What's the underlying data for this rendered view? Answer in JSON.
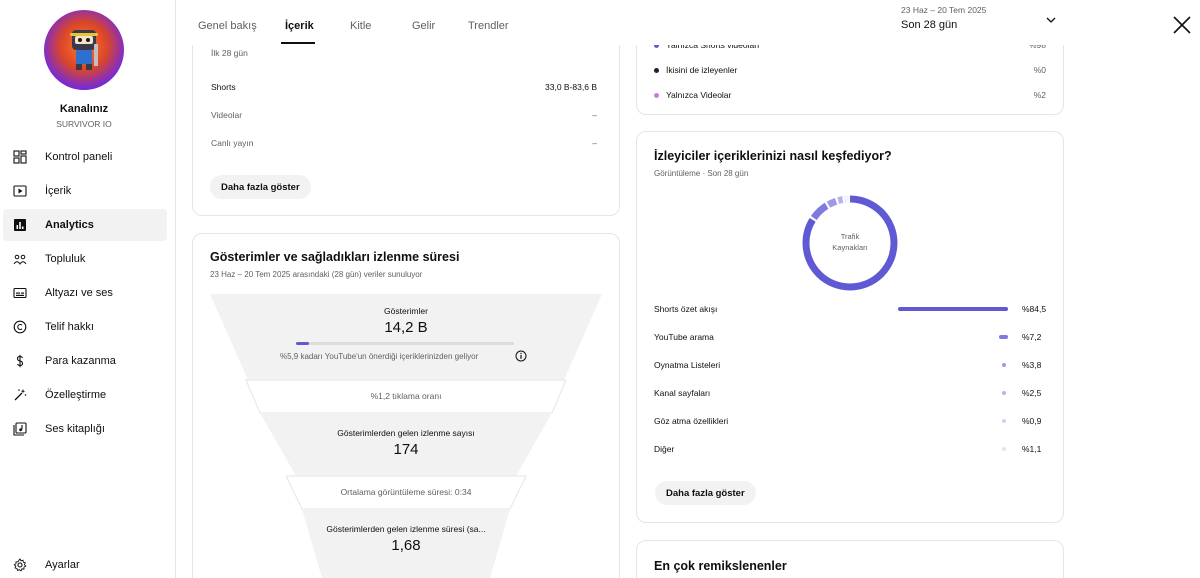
{
  "sidebar": {
    "channel_name": "Kanalınız",
    "channel_handle": "SURVIVOR IO",
    "items": [
      {
        "label": "Kontrol paneli",
        "icon": "dashboard-icon"
      },
      {
        "label": "İçerik",
        "icon": "content-icon"
      },
      {
        "label": "Analytics",
        "icon": "analytics-icon",
        "active": true
      },
      {
        "label": "Topluluk",
        "icon": "community-icon"
      },
      {
        "label": "Altyazı ve ses",
        "icon": "subtitles-icon"
      },
      {
        "label": "Telif hakkı",
        "icon": "copyright-icon"
      },
      {
        "label": "Para kazanma",
        "icon": "monetization-icon"
      },
      {
        "label": "Özelleştirme",
        "icon": "customization-icon"
      },
      {
        "label": "Ses kitaplığı",
        "icon": "audio-library-icon"
      }
    ],
    "settings_label": "Ayarlar"
  },
  "topbar": {
    "tabs": [
      "Genel bakış",
      "İçerik",
      "Kitle",
      "Gelir",
      "Trendler"
    ],
    "active_tab": "İçerik",
    "date_range": "23 Haz – 20 Tem 2025",
    "period": "Son 28 gün"
  },
  "top_left_card": {
    "subtitle": "İlk 28 gün",
    "rows": [
      {
        "label": "Shorts",
        "value": "33,0 B-83,6 B"
      },
      {
        "label": "Videolar",
        "value": "–"
      },
      {
        "label": "Canlı yayın",
        "value": "–"
      }
    ],
    "more_button": "Daha fazla göster"
  },
  "impressions_card": {
    "title": "Gösterimler ve sağladıkları izlenme süresi",
    "subtitle": "23 Haz – 20 Tem 2025 arasındaki (28 gün) veriler sunuluyor",
    "impressions_label": "Gösterimler",
    "impressions_value": "14,2 B",
    "recommended_share": 0.059,
    "recommended_note": "%5,9 kadarı YouTube'un önerdiği içeriklerinizden geliyor",
    "ctr": "%1,2 tıklama oranı",
    "views_label": "Gösterimlerden gelen izlenme sayısı",
    "views_value": "174",
    "avg_duration": "Ortalama görüntüleme süresi: 0:34",
    "watch_time_label": "Gösterimlerden gelen izlenme süresi (sa...",
    "watch_time_value": "1,68"
  },
  "top_right_card": {
    "rows": [
      {
        "label": "Yalnızca Shorts videoları",
        "value": "%98",
        "color": "#5f5ad4"
      },
      {
        "label": "İkisini de izleyenler",
        "value": "%0",
        "color": "#1f1f3a"
      },
      {
        "label": "Yalnızca Videolar",
        "value": "%2",
        "color": "#c77dd9"
      }
    ]
  },
  "traffic_card": {
    "title": "İzleyiciler içeriklerinizi nasıl keşfediyor?",
    "subtitle": "Görüntüleme · Son 28 gün",
    "donut_label_line1": "Trafik",
    "donut_label_line2": "Kaynakları",
    "sources": [
      {
        "label": "Shorts özet akışı",
        "value": "%84,5",
        "pct": 84.5,
        "color": "#5f5ad4"
      },
      {
        "label": "YouTube arama",
        "value": "%7,2",
        "pct": 7.2,
        "color": "#7f7ae0"
      },
      {
        "label": "Oynatma Listeleri",
        "value": "%3,8",
        "pct": 3.8,
        "color": "#9d99e8"
      },
      {
        "label": "Kanal sayfaları",
        "value": "%2,5",
        "pct": 2.5,
        "color": "#b6b3ee"
      },
      {
        "label": "Göz atma özellikleri",
        "value": "%0,9",
        "pct": 0.9,
        "color": "#d0cef5"
      },
      {
        "label": "Diğer",
        "value": "%1,1",
        "pct": 1.1,
        "color": "#e3e2f8"
      }
    ],
    "more_button": "Daha fazla göster"
  },
  "remix_card": {
    "title": "En çok remikslenenler"
  }
}
